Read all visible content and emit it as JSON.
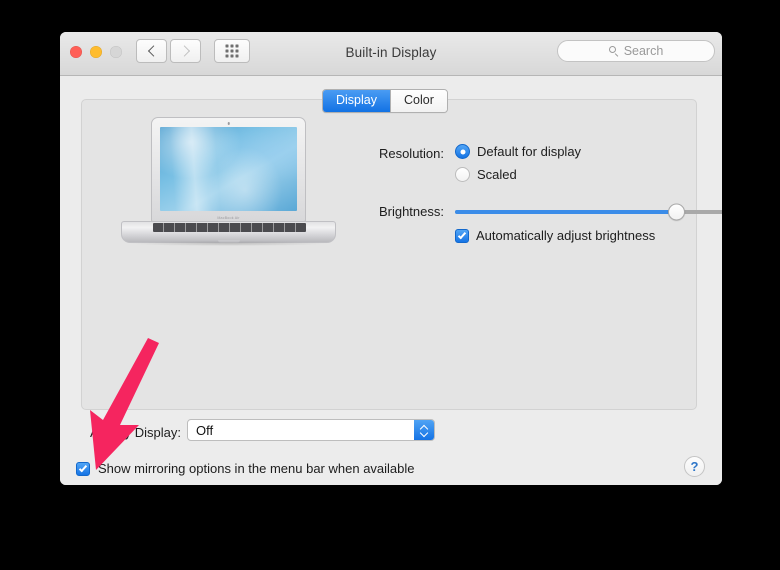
{
  "window": {
    "title": "Built-in Display",
    "traffic_lights": [
      "close",
      "minimize",
      "zoom"
    ],
    "nav": {
      "back": "back-arrow",
      "forward": "forward-arrow",
      "grid": "show-all-grid"
    },
    "search": {
      "placeholder": "Search",
      "value": "",
      "icon": "search-icon"
    }
  },
  "tabs": [
    {
      "label": "Display",
      "active": true
    },
    {
      "label": "Color",
      "active": false
    }
  ],
  "preview": {
    "device": "MacBook Air",
    "chin_label": "MacBook Air"
  },
  "display_settings": {
    "resolution": {
      "label": "Resolution:",
      "options": [
        {
          "label": "Default for display",
          "selected": true
        },
        {
          "label": "Scaled",
          "selected": false
        }
      ]
    },
    "brightness": {
      "label": "Brightness:",
      "value_percent": 73,
      "auto_adjust": {
        "label": "Automatically adjust brightness",
        "checked": true
      }
    }
  },
  "airplay": {
    "label": "AirPlay Display:",
    "value": "Off",
    "options": [
      "Off"
    ],
    "mirroring": {
      "label": "Show mirroring options in the menu bar when available",
      "checked": true
    }
  },
  "help": {
    "label": "?"
  },
  "annotation": {
    "type": "arrow",
    "color": "#f5255f",
    "points_to": "show-mirroring-checkbox"
  },
  "colors": {
    "accent_blue": "#1574e5",
    "window_bg": "#ececec",
    "panel_bg": "#e4e4e4",
    "page_bg": "#000000",
    "annotation_pink": "#f5255f"
  }
}
